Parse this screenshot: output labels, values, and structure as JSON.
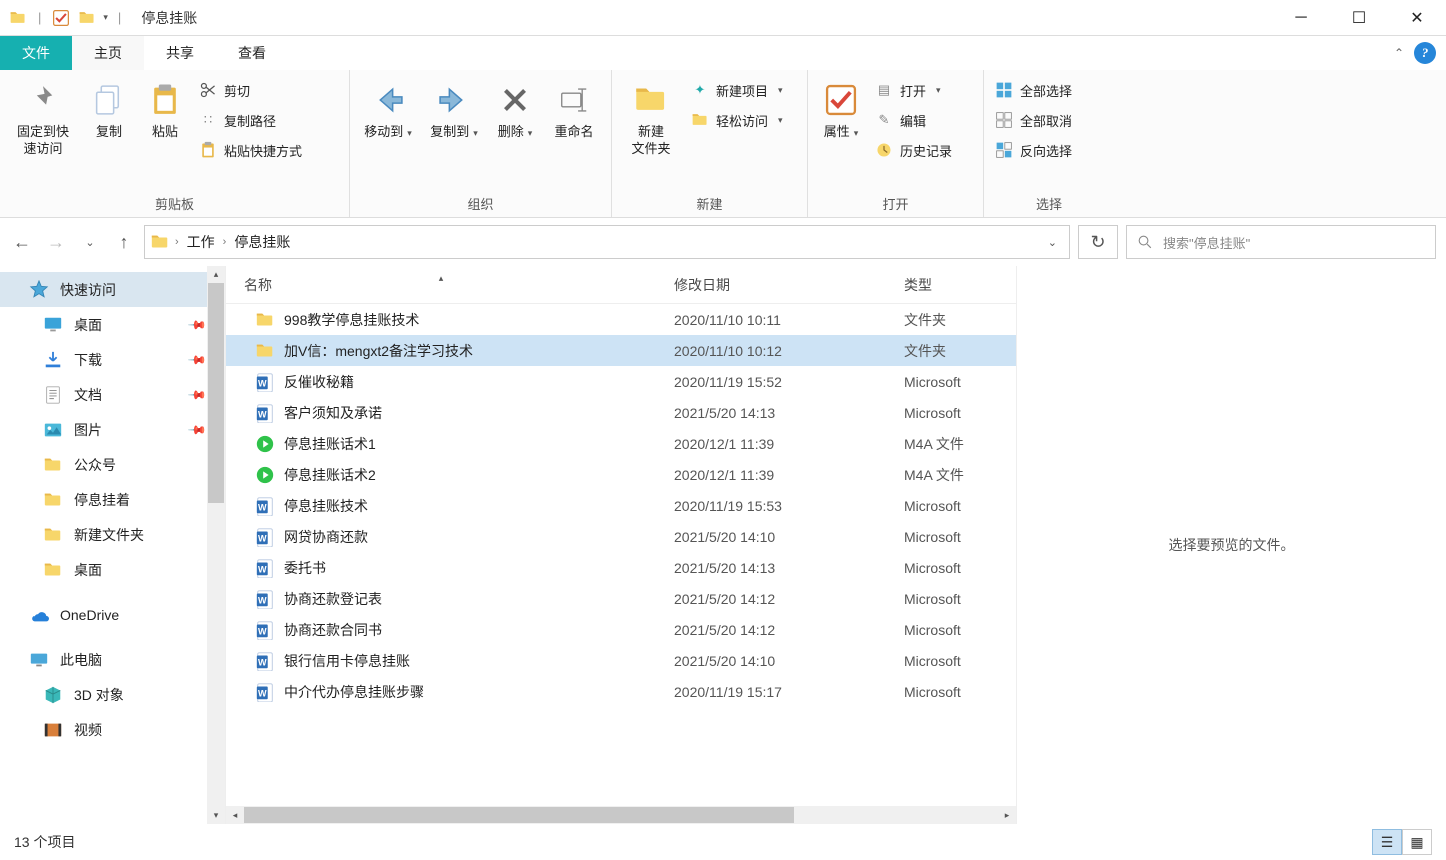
{
  "title": "停息挂账",
  "ribbon_tabs": {
    "file": "文件",
    "home": "主页",
    "share": "共享",
    "view": "查看"
  },
  "ribbon": {
    "clipboard": {
      "pin": "固定到快\n速访问",
      "copy": "复制",
      "paste": "粘贴",
      "cut": "剪切",
      "copypath": "复制路径",
      "pasteshortcut": "粘贴快捷方式",
      "label": "剪贴板"
    },
    "organize": {
      "moveto": "移动到",
      "copyto": "复制到",
      "delete": "删除",
      "rename": "重命名",
      "label": "组织"
    },
    "new": {
      "newfolder": "新建\n文件夹",
      "newitem": "新建项目",
      "easyaccess": "轻松访问",
      "label": "新建"
    },
    "open": {
      "properties": "属性",
      "open": "打开",
      "edit": "编辑",
      "history": "历史记录",
      "label": "打开"
    },
    "select": {
      "all": "全部选择",
      "none": "全部取消",
      "invert": "反向选择",
      "label": "选择"
    }
  },
  "breadcrumb": {
    "seg1": "工作",
    "seg2": "停息挂账"
  },
  "search_placeholder": "搜索\"停息挂账\"",
  "sidebar": {
    "quick": "快速访问",
    "desktop": "桌面",
    "downloads": "下载",
    "documents": "文档",
    "pictures": "图片",
    "f1": "公众号",
    "f2": "停息挂着",
    "f3": "新建文件夹",
    "f4": "桌面",
    "onedrive": "OneDrive",
    "thispc": "此电脑",
    "3d": "3D 对象",
    "video": "视频"
  },
  "columns": {
    "name": "名称",
    "date": "修改日期",
    "type": "类型"
  },
  "files": [
    {
      "icon": "folder",
      "name": "998教学停息挂账技术",
      "date": "2020/11/10 10:11",
      "type": "文件夹"
    },
    {
      "icon": "folder",
      "name": "加V信：mengxt2备注学习技术",
      "date": "2020/11/10 10:12",
      "type": "文件夹",
      "selected": true
    },
    {
      "icon": "word",
      "name": "反催收秘籍",
      "date": "2020/11/19 15:52",
      "type": "Microsoft"
    },
    {
      "icon": "word",
      "name": "客户须知及承诺",
      "date": "2021/5/20 14:13",
      "type": "Microsoft"
    },
    {
      "icon": "audio",
      "name": "停息挂账话术1",
      "date": "2020/12/1 11:39",
      "type": "M4A 文件"
    },
    {
      "icon": "audio",
      "name": "停息挂账话术2",
      "date": "2020/12/1 11:39",
      "type": "M4A 文件"
    },
    {
      "icon": "word",
      "name": "停息挂账技术",
      "date": "2020/11/19 15:53",
      "type": "Microsoft"
    },
    {
      "icon": "word",
      "name": "网贷协商还款",
      "date": "2021/5/20 14:10",
      "type": "Microsoft"
    },
    {
      "icon": "word",
      "name": "委托书",
      "date": "2021/5/20 14:13",
      "type": "Microsoft"
    },
    {
      "icon": "word",
      "name": "协商还款登记表",
      "date": "2021/5/20 14:12",
      "type": "Microsoft"
    },
    {
      "icon": "word",
      "name": "协商还款合同书",
      "date": "2021/5/20 14:12",
      "type": "Microsoft"
    },
    {
      "icon": "word",
      "name": "银行信用卡停息挂账",
      "date": "2021/5/20 14:10",
      "type": "Microsoft"
    },
    {
      "icon": "word",
      "name": "中介代办停息挂账步骤",
      "date": "2020/11/19 15:17",
      "type": "Microsoft"
    }
  ],
  "preview_hint": "选择要预览的文件。",
  "status_text": "13 个项目"
}
